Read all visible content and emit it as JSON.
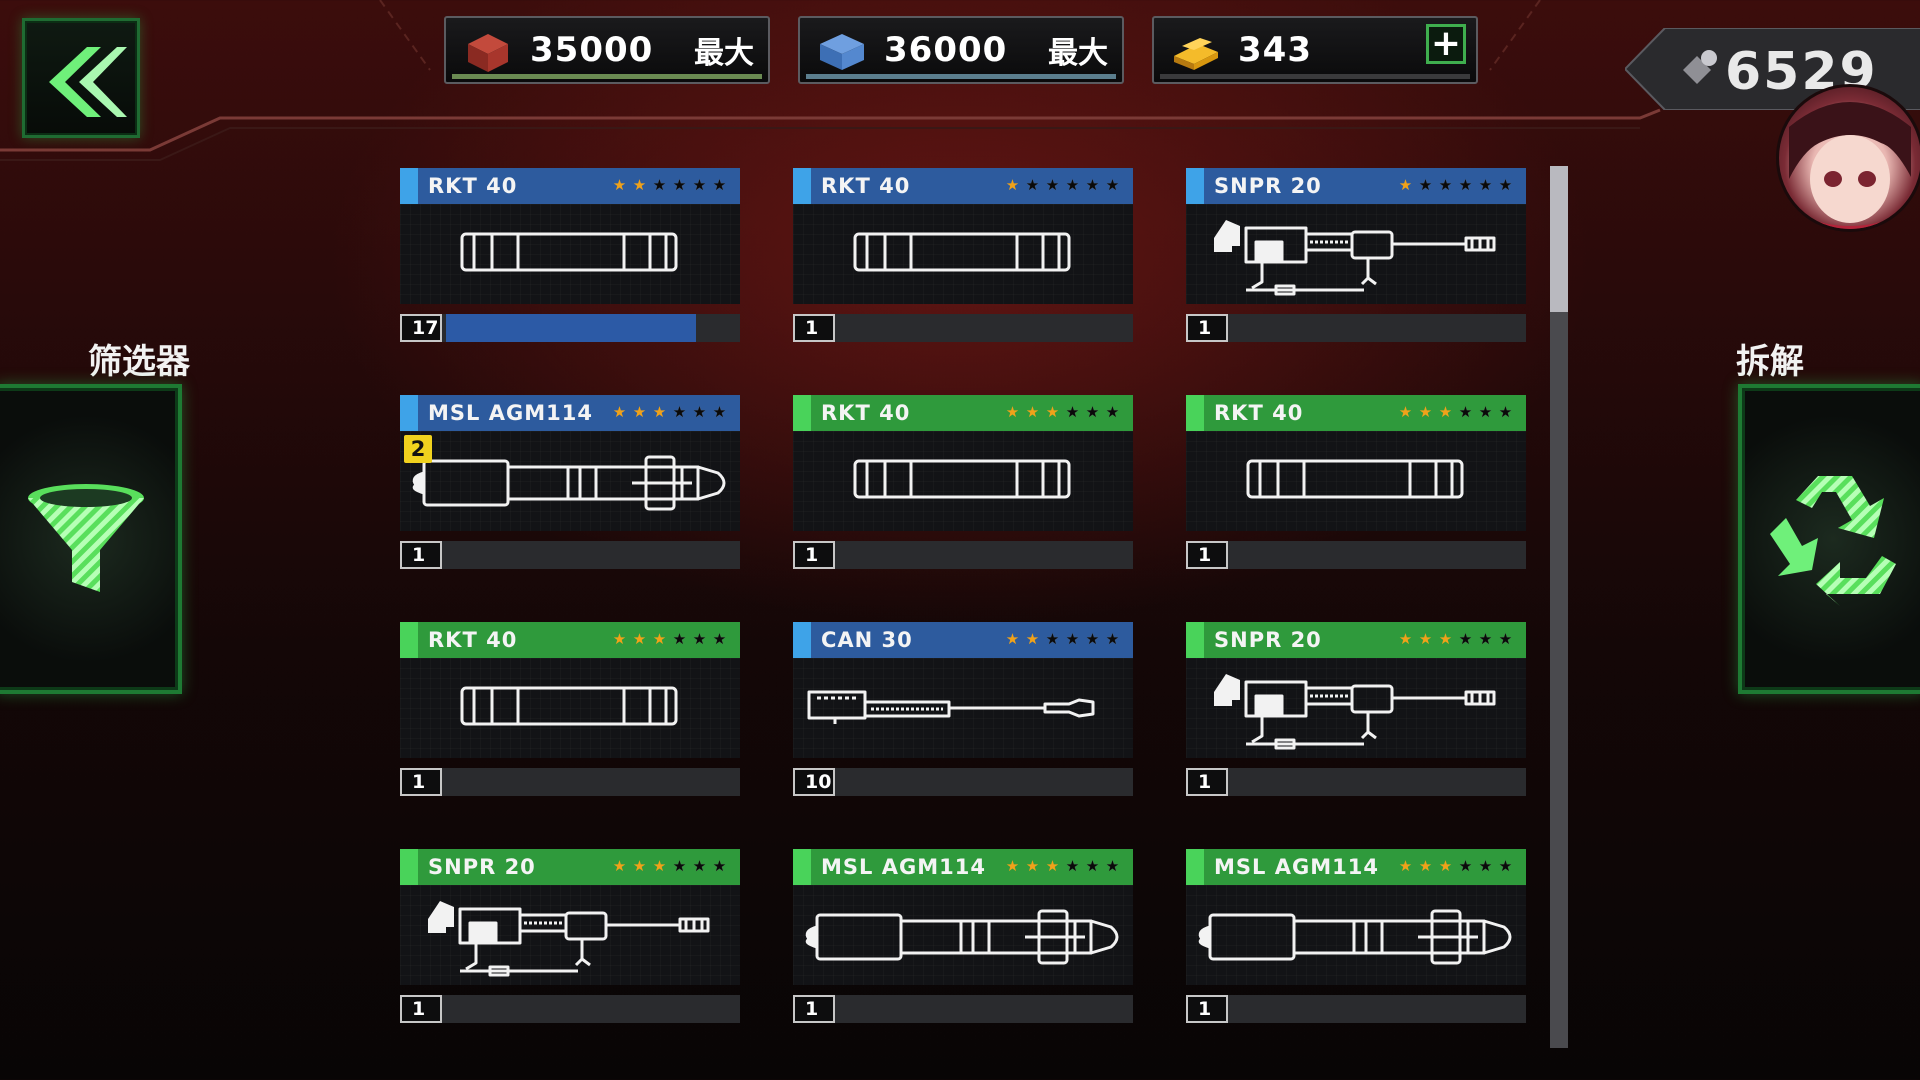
{
  "top": {
    "resources": [
      {
        "id": "steel",
        "value": "35000",
        "max_label": "最大",
        "bar_color": "#6a8a52"
      },
      {
        "id": "plate",
        "value": "36000",
        "max_label": "最大",
        "bar_color": "#5b7e8e"
      },
      {
        "id": "gold",
        "value": "343",
        "plus_label": "+",
        "bar_color": "#3a3a3c"
      }
    ],
    "currency": {
      "value": "6529",
      "icon": "bolt-icon"
    }
  },
  "side": {
    "filter_label": "筛选器",
    "dismantle_label": "拆解"
  },
  "colors": {
    "blue": "#2d5b9e",
    "green": "#2f9a3c",
    "green_stripe": "#49d35a",
    "blue_stripe": "#3ea3e8",
    "star_on": "#f0a21a"
  },
  "items": [
    {
      "name": "RKT 40",
      "rarity": "blue",
      "stars_on": 2,
      "qty": "17",
      "progress": 0.85,
      "weapon": "rocket"
    },
    {
      "name": "RKT 40",
      "rarity": "blue",
      "stars_on": 1,
      "qty": "1",
      "progress": 0,
      "weapon": "rocket"
    },
    {
      "name": "SNPR 20",
      "rarity": "blue",
      "stars_on": 1,
      "qty": "1",
      "progress": 0,
      "weapon": "sniper"
    },
    {
      "name": "MSL AGM114",
      "rarity": "blue",
      "stars_on": 3,
      "qty": "1",
      "progress": 0,
      "weapon": "missile",
      "badge": "2"
    },
    {
      "name": "RKT 40",
      "rarity": "green",
      "stars_on": 3,
      "qty": "1",
      "progress": 0,
      "weapon": "rocket"
    },
    {
      "name": "RKT 40",
      "rarity": "green",
      "stars_on": 3,
      "qty": "1",
      "progress": 0,
      "weapon": "rocket"
    },
    {
      "name": "RKT 40",
      "rarity": "green",
      "stars_on": 3,
      "qty": "1",
      "progress": 0,
      "weapon": "rocket"
    },
    {
      "name": "CAN 30",
      "rarity": "blue",
      "stars_on": 2,
      "qty": "10",
      "progress": 0,
      "weapon": "cannon"
    },
    {
      "name": "SNPR 20",
      "rarity": "green",
      "stars_on": 3,
      "qty": "1",
      "progress": 0,
      "weapon": "sniper"
    },
    {
      "name": "SNPR 20",
      "rarity": "green",
      "stars_on": 3,
      "qty": "1",
      "progress": 0,
      "weapon": "sniper"
    },
    {
      "name": "MSL AGM114",
      "rarity": "green",
      "stars_on": 3,
      "qty": "1",
      "progress": 0,
      "weapon": "missile"
    },
    {
      "name": "MSL AGM114",
      "rarity": "green",
      "stars_on": 3,
      "qty": "1",
      "progress": 0,
      "weapon": "missile"
    }
  ]
}
